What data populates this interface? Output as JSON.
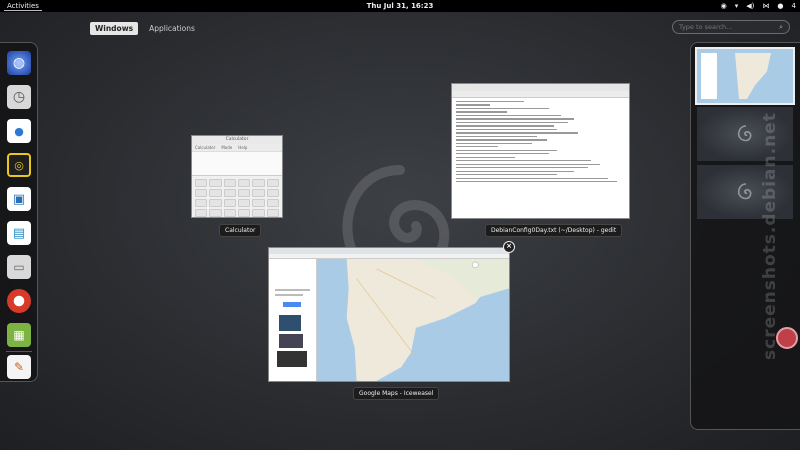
{
  "topbar": {
    "activities": "Activities",
    "clock": "Thu Jul 31, 16:23",
    "tray_count": "4"
  },
  "view_selector": {
    "windows": "Windows",
    "applications": "Applications"
  },
  "search": {
    "placeholder": "Type to search..."
  },
  "windows": [
    {
      "label": "Calculator",
      "title": "Calculator",
      "menu": [
        "Calculator",
        "Mode",
        "Help"
      ]
    },
    {
      "label": "DebianConfig0Day.txt (~/Desktop) - gedit"
    },
    {
      "label": "Google Maps - Iceweasel"
    }
  ],
  "dash_apps": [
    {
      "name": "browser",
      "glyph": "🌐",
      "color": "#3a6fd8"
    },
    {
      "name": "mail-clock",
      "glyph": "✉",
      "color": "#e8e8e8"
    },
    {
      "name": "chat",
      "glyph": "💬",
      "color": "#5a9be0"
    },
    {
      "name": "music",
      "glyph": "♫",
      "color": "#f0d030"
    },
    {
      "name": "photos",
      "glyph": "▦",
      "color": "#3080c0"
    },
    {
      "name": "document",
      "glyph": "▤",
      "color": "#ffffff"
    },
    {
      "name": "files",
      "glyph": "▭",
      "color": "#cfcfcf"
    },
    {
      "name": "help",
      "glyph": "◎",
      "color": "#e04030"
    },
    {
      "name": "calculator",
      "glyph": "▦",
      "color": "#8cc04a"
    },
    {
      "name": "text-editor",
      "glyph": "✎",
      "color": "#f0f0f0"
    }
  ],
  "colors": {
    "topbar": "#000000",
    "accent": "#eeeeee"
  },
  "watermark": "screenshots.debian.net"
}
